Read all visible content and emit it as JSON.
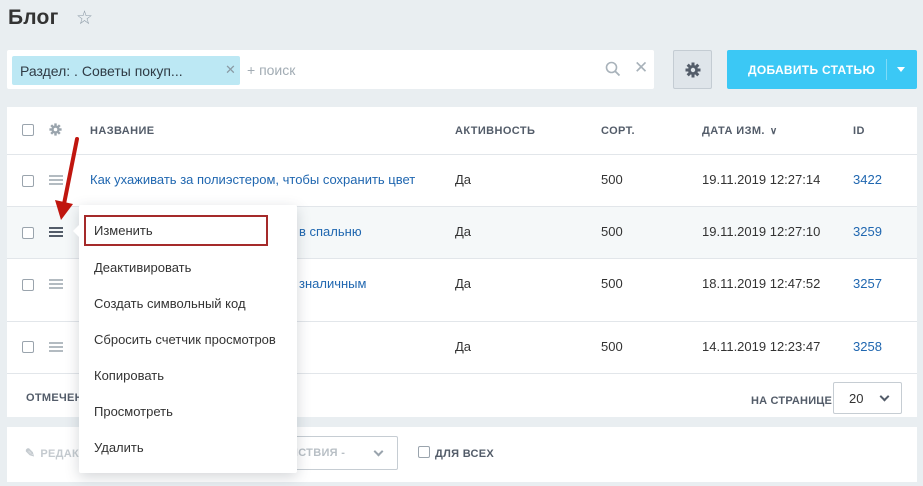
{
  "header": {
    "title": "Блог"
  },
  "filter": {
    "chip_label": "Раздел: . Советы покуп...",
    "search_placeholder": "+ поиск"
  },
  "toolbar": {
    "add_label": "ДОБАВИТЬ СТАТЬЮ"
  },
  "table": {
    "columns": [
      "НАЗВАНИЕ",
      "АКТИВНОСТЬ",
      "СОРТ.",
      "ДАТА ИЗМ.",
      "ID"
    ],
    "sort_indicator": "∨",
    "rows": [
      {
        "name": "Как ухаживать за полиэстером, чтобы сохранить цвет",
        "active": "Да",
        "sort": "500",
        "date": "19.11.2019 12:27:14",
        "id": "3422"
      },
      {
        "name": "в спальню",
        "active": "Да",
        "sort": "500",
        "date": "19.11.2019 12:27:10",
        "id": "3259"
      },
      {
        "name": "зналичным",
        "active": "Да",
        "sort": "500",
        "date": "18.11.2019 12:47:52",
        "id": "3257"
      },
      {
        "name": "",
        "active": "Да",
        "sort": "500",
        "date": "14.11.2019 12:23:47",
        "id": "3258"
      }
    ]
  },
  "footer": {
    "marked_label": "ОТМЕЧЕН",
    "per_page_label": "НА СТРАНИЦЕ:",
    "per_page_value": "20"
  },
  "action_bar": {
    "edit_label": "РЕДАК",
    "actions_label": "ЙСТВИЯ -",
    "for_all_label": "ДЛЯ ВСЕХ"
  },
  "context_menu": {
    "items": [
      "Изменить",
      "Деактивировать",
      "Создать символьный код",
      "Сбросить счетчик просмотров",
      "Копировать",
      "Просмотреть",
      "Удалить"
    ]
  },
  "colors": {
    "accent": "#3bc8f5",
    "link": "#2067b0",
    "highlight": "#a52a2a",
    "arrow": "#c0160f"
  }
}
